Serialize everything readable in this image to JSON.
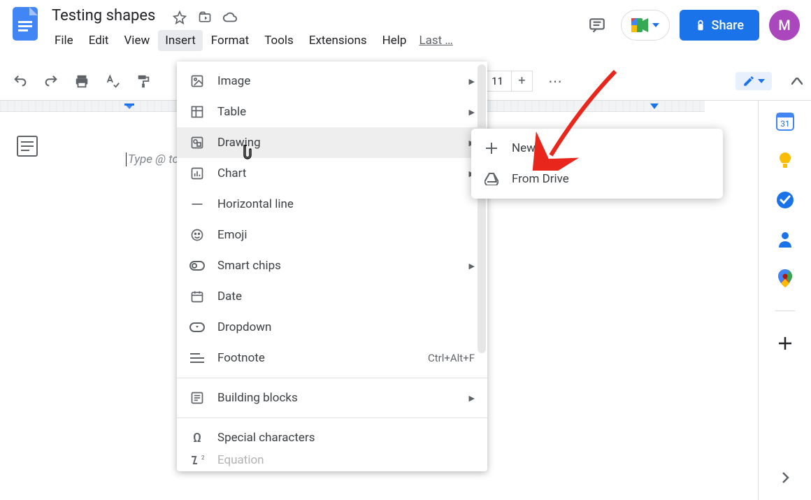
{
  "header": {
    "doc_title": "Testing shapes",
    "menus": [
      "File",
      "Edit",
      "View",
      "Insert",
      "Format",
      "Tools",
      "Extensions",
      "Help"
    ],
    "active_menu_index": 3,
    "last_edit": "Last …",
    "share_label": "Share",
    "avatar_letter": "M"
  },
  "toolbar": {
    "font_size": "11"
  },
  "document": {
    "placeholder": "Type @ to insert"
  },
  "insert_menu": {
    "items": [
      {
        "id": "image",
        "label": "Image",
        "submenu": true
      },
      {
        "id": "table",
        "label": "Table",
        "submenu": true
      },
      {
        "id": "drawing",
        "label": "Drawing",
        "submenu": true,
        "hover": true
      },
      {
        "id": "chart",
        "label": "Chart",
        "submenu": true
      },
      {
        "id": "hline",
        "label": "Horizontal line"
      },
      {
        "id": "emoji",
        "label": "Emoji"
      },
      {
        "id": "smartchips",
        "label": "Smart chips",
        "submenu": true
      },
      {
        "id": "date",
        "label": "Date"
      },
      {
        "id": "dropdown",
        "label": "Dropdown"
      },
      {
        "id": "footnote",
        "label": "Footnote",
        "shortcut": "Ctrl+Alt+F"
      },
      {
        "sep": true
      },
      {
        "id": "blocks",
        "label": "Building blocks",
        "submenu": true
      },
      {
        "sep": true
      },
      {
        "id": "special",
        "label": "Special characters"
      },
      {
        "id": "equation",
        "label": "Equation"
      }
    ]
  },
  "drawing_submenu": {
    "items": [
      {
        "id": "new",
        "label": "New"
      },
      {
        "id": "fromdrive",
        "label": "From Drive"
      }
    ]
  },
  "sidepanel": {
    "items": [
      "calendar",
      "keep",
      "tasks",
      "contacts",
      "maps"
    ]
  }
}
